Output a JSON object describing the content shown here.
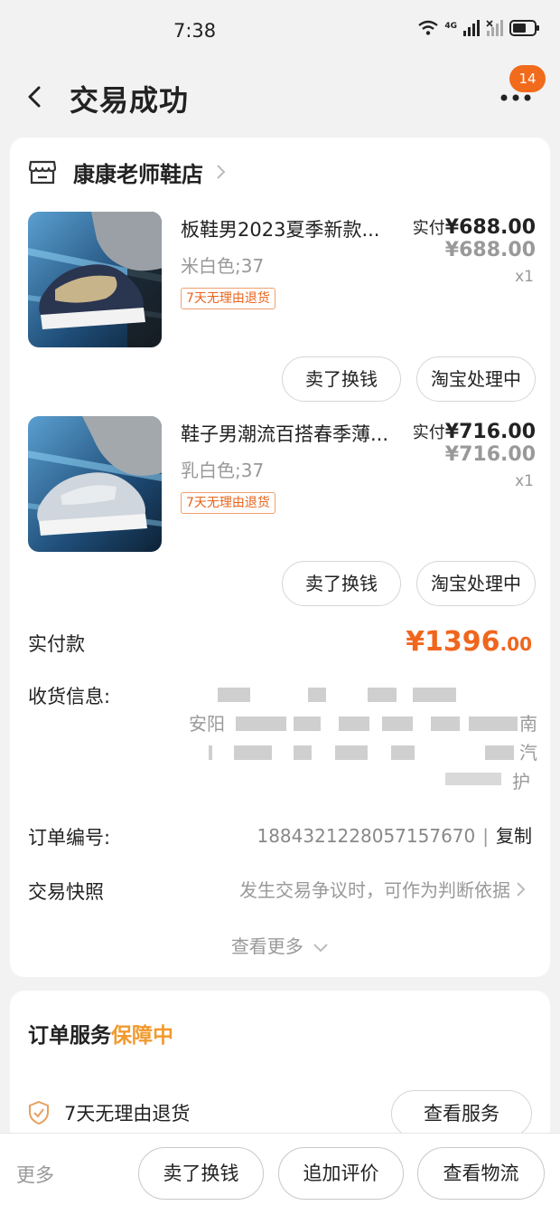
{
  "status": {
    "time": "7:38",
    "net": "4G"
  },
  "nav": {
    "title": "交易成功",
    "badge": "14"
  },
  "shop": {
    "name": "康康老师鞋店"
  },
  "items": [
    {
      "title": "板鞋男2023夏季新款...",
      "spec": "米白色;37",
      "tag": "7天无理由退货",
      "paid_label": "实付",
      "paid": "¥688.00",
      "orig": "¥688.00",
      "qty": "x1",
      "btn_sell": "卖了换钱",
      "btn_proc": "淘宝处理中"
    },
    {
      "title": "鞋子男潮流百搭春季薄...",
      "spec": "乳白色;37",
      "tag": "7天无理由退货",
      "paid_label": "实付",
      "paid": "¥716.00",
      "orig": "¥716.00",
      "qty": "x1",
      "btn_sell": "卖了换钱",
      "btn_proc": "淘宝处理中"
    }
  ],
  "summary": {
    "paid_label": "实付款",
    "paid_total_major": "¥1396",
    "paid_total_minor": ".00",
    "address_label": "收货信息:",
    "address_line1": "安阳",
    "address_line1_end": "南",
    "address_line2_end": "汽",
    "address_line3_end": "护",
    "order_label": "订单编号:",
    "order_no": "1884321228057157670",
    "copy_label": "复制",
    "snapshot_label": "交易快照",
    "snapshot_hint": "发生交易争议时，可作为判断依据",
    "see_more": "查看更多"
  },
  "service": {
    "title": "订单服务",
    "title_highlight": "保障中",
    "item": "7天无理由退货",
    "button": "查看服务"
  },
  "bottom": {
    "more": "更多",
    "sell": "卖了换钱",
    "review": "追加评价",
    "logistics": "查看物流"
  },
  "colors": {
    "accent": "#f0661e",
    "badge": "#f26a1b",
    "highlight": "#f29a2e"
  }
}
